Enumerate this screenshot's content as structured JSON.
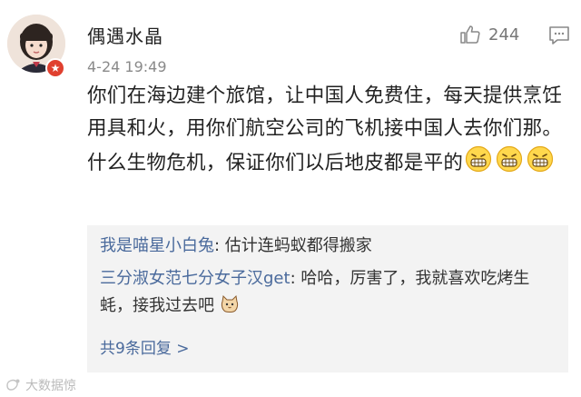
{
  "post": {
    "username": "偶遇水晶",
    "timestamp": "4-24 19:49",
    "like_count": "244",
    "text": "你们在海边建个旅馆，让中国人免费住，每天提供烹饪用具和火，用你们航空公司的飞机接中国人去你们那。什么生物危机，保证你们以后地皮都是平的",
    "emoji_icons": [
      "grin-emoji-icon",
      "grin-emoji-icon",
      "grin-emoji-icon"
    ]
  },
  "replies": [
    {
      "author": "我是喵星小白兔",
      "separator": ": ",
      "text": "估计连蚂蚁都得搬家"
    },
    {
      "author": "三分淑女范七分女子汉get",
      "separator": ": ",
      "text": "哈哈，厉害了，我就喜欢吃烤生蚝，接我过去吧",
      "trailing_icon": "cat-emoji-icon"
    }
  ],
  "more_replies": "共9条回复 >",
  "watermark": "大数据惊",
  "colors": {
    "link": "#4a6a9c",
    "reply_bg": "#f3f3f3",
    "badge": "#e0402f",
    "muted": "#8a8a8a"
  }
}
